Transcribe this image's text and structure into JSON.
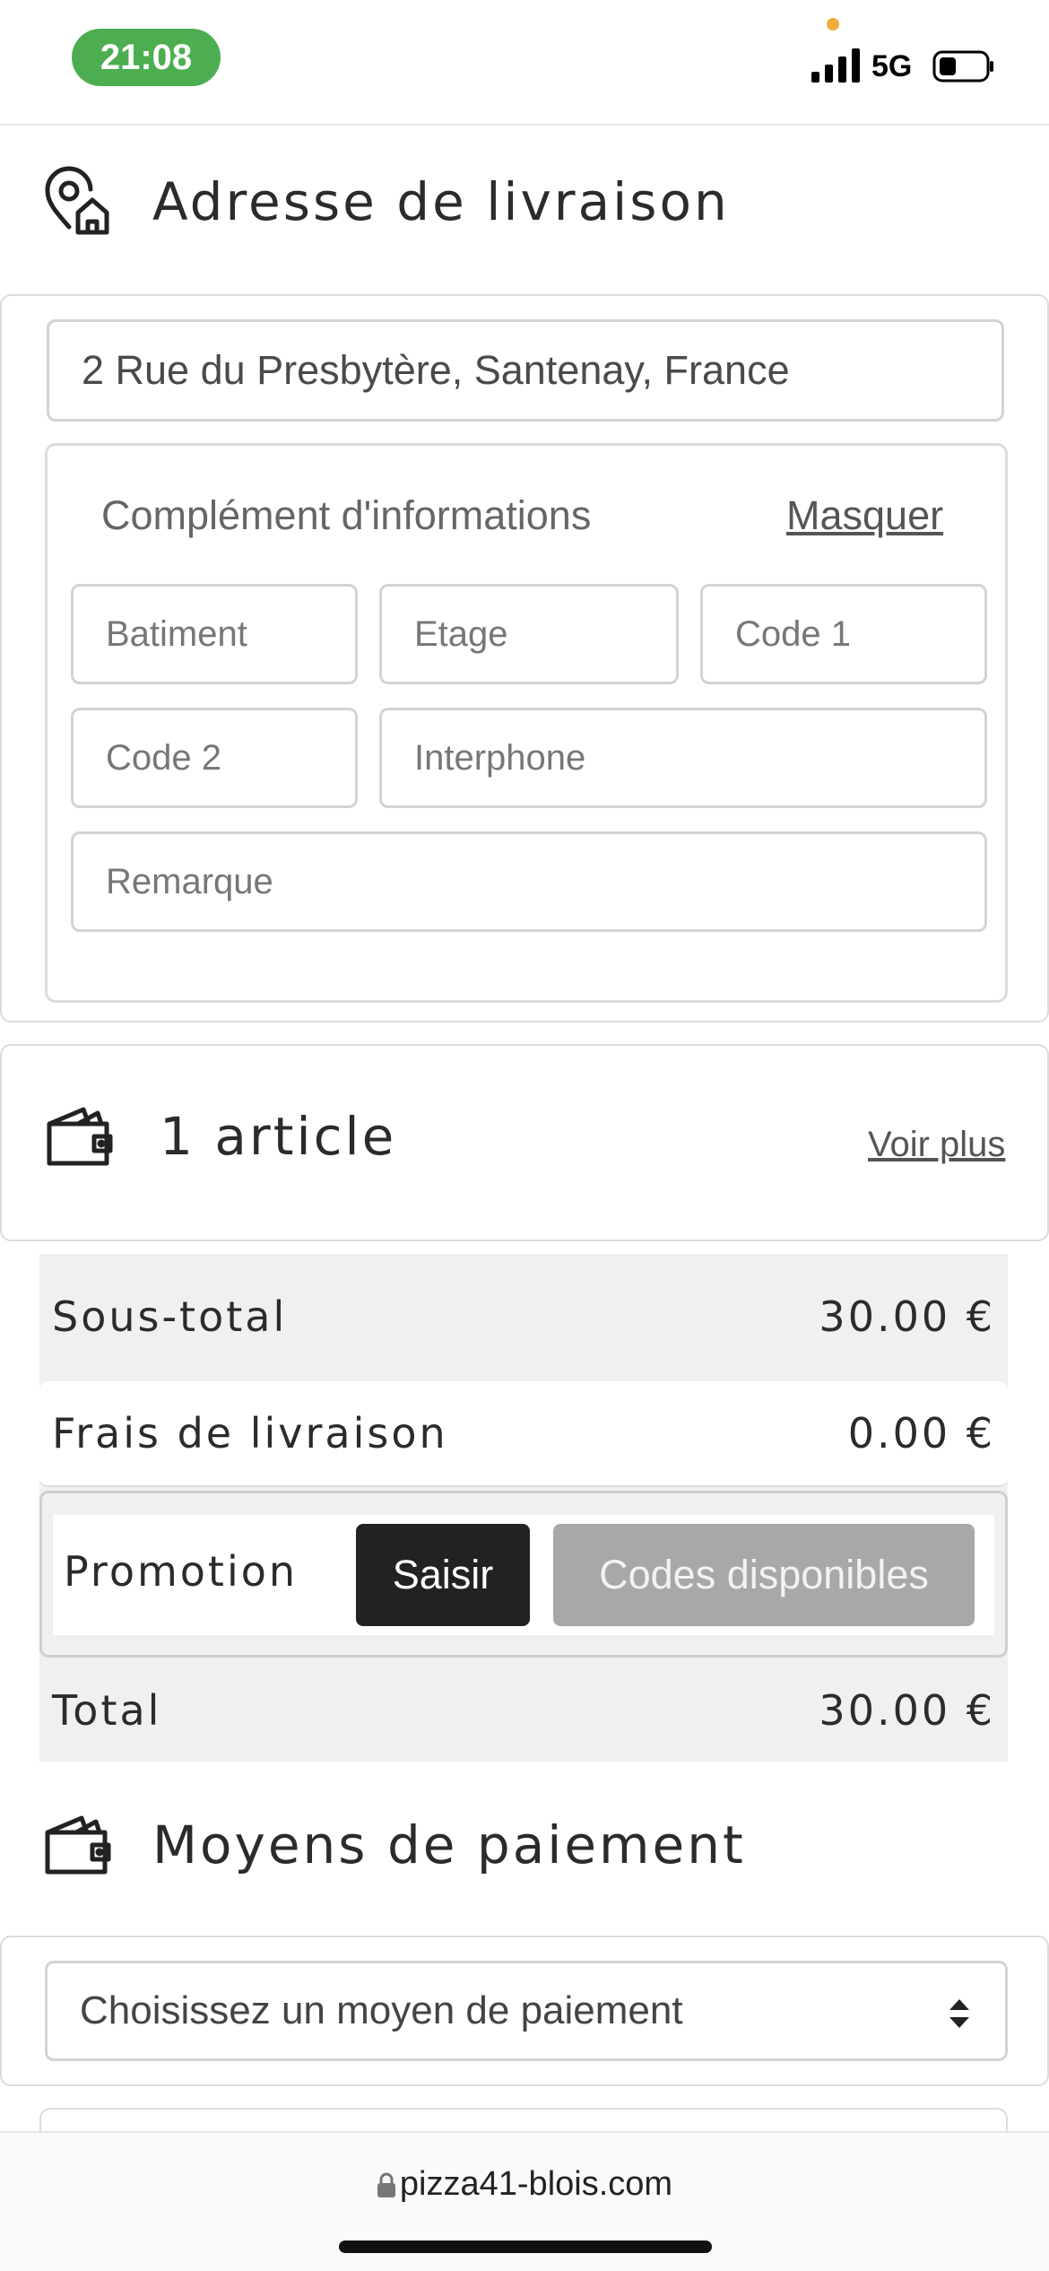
{
  "status_bar": {
    "time": "21:08",
    "network": "5G",
    "icons": [
      "signal-icon",
      "battery-icon"
    ]
  },
  "delivery": {
    "title": "Adresse de livraison",
    "icon": "location-home-icon",
    "address_value": "2 Rue du Presbytère, Santenay, France",
    "details": {
      "title": "Complément d'informations",
      "hide_link": "Masquer",
      "building_placeholder": "Batiment",
      "floor_placeholder": "Etage",
      "code1_placeholder": "Code 1",
      "code2_placeholder": "Code 2",
      "intercom_placeholder": "Interphone",
      "remark_placeholder": "Remarque"
    }
  },
  "cart": {
    "title": "1 article",
    "icon": "wallet-icon",
    "see_more": "Voir plus"
  },
  "summary": {
    "subtotal_label": "Sous-total",
    "subtotal_value": "30.00 €",
    "delivery_label": "Frais de livraison",
    "delivery_value": "0.00 €",
    "promo_label": "Promotion",
    "enter_button": "Saisir",
    "codes_button": "Codes disponibles",
    "total_label": "Total",
    "total_value": "30.00 €"
  },
  "payment": {
    "title": "Moyens de paiement",
    "icon": "wallet-icon",
    "select_value": "Choisissez un moyen de paiement"
  },
  "browser": {
    "url": "pizza41-blois.com"
  },
  "colors": {
    "time_pill": "#4cae50",
    "dark_button": "#222222",
    "grey_button": "#a8a8a8",
    "summary_bg": "#f0f0f0"
  }
}
